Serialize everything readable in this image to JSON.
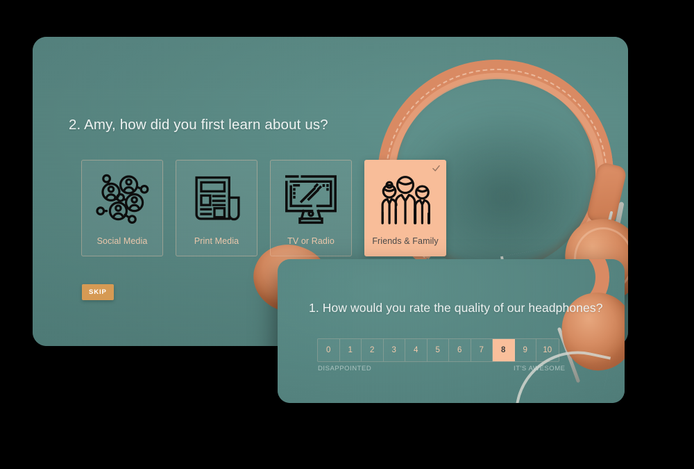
{
  "theme": {
    "panel_teal": "#5a8a86",
    "accent_peach": "#f8bd99",
    "accent_tan": "#ebc7ab",
    "skip_orange": "#d69a54",
    "page_background": "#000000"
  },
  "survey": {
    "question2": {
      "number": "2.",
      "title": "2. Amy, how did you first learn about us?",
      "skip_label": "SKIP",
      "check_icon": "check-icon",
      "options": [
        {
          "id": "social-media",
          "label": "Social Media",
          "icon": "social-network-icon",
          "selected": false
        },
        {
          "id": "print-media",
          "label": "Print Media",
          "icon": "newspaper-icon",
          "selected": false
        },
        {
          "id": "tv-or-radio",
          "label": "TV or Radio",
          "icon": "television-icon",
          "selected": false
        },
        {
          "id": "friends-family",
          "label": "Friends & Family",
          "icon": "people-group-icon",
          "selected": true
        }
      ]
    },
    "question1": {
      "number": "1.",
      "title": "1. How would you rate the quality of our headphones?",
      "scale": {
        "values": [
          "0",
          "1",
          "2",
          "3",
          "4",
          "5",
          "6",
          "7",
          "8",
          "9",
          "10"
        ],
        "selected_value": "8",
        "low_label": "DISAPPOINTED",
        "high_label": "IT'S AWESOME"
      }
    }
  }
}
